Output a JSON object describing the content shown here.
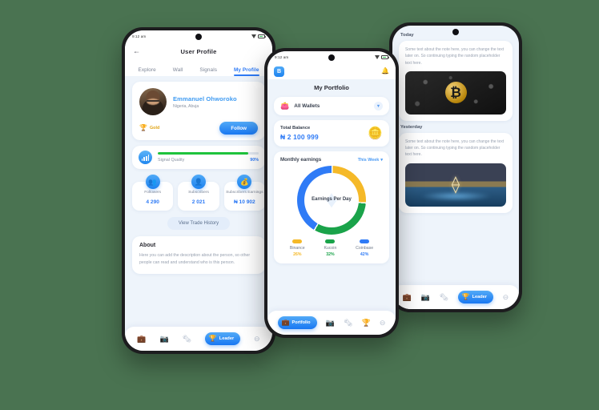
{
  "background_color": "#4a7351",
  "accent_color": "#2f7bf6",
  "phones": {
    "left": {
      "status_bar": {
        "time": "9:12 am",
        "wifi_icon": "wifi-icon",
        "battery_icon": "battery-icon"
      },
      "header": {
        "back_icon": "back-arrow-icon",
        "title": "User Profile"
      },
      "tabs": [
        {
          "label": "Explore",
          "active": false
        },
        {
          "label": "Wall",
          "active": false
        },
        {
          "label": "Signals",
          "active": false
        },
        {
          "label": "My Profile",
          "active": true
        }
      ],
      "profile": {
        "avatar": "user-avatar",
        "name": "Emmanuel Ohworoko",
        "location": "Nigeria, Abuja",
        "badge_icon": "trophy-icon",
        "badge_label": "Gold",
        "follow_label": "Follow"
      },
      "signal": {
        "icon": "signal-bars-icon",
        "label": "Signal Quality",
        "percent_label": "90%",
        "percent_value": 90,
        "bar_color": "#1ec33c"
      },
      "stats": [
        {
          "icon": "followers-icon",
          "glyph": "\u0001",
          "label": "Followers",
          "value": "4 290"
        },
        {
          "icon": "subscribers-icon",
          "glyph": "\u0001",
          "label": "Subscribers",
          "value": "2 021"
        },
        {
          "icon": "subscribers-earnings-icon",
          "glyph": "\u0001",
          "label": "Subscribers Earnings",
          "value": "₦ 10 902"
        }
      ],
      "history_button": "View Trade History",
      "about": {
        "title": "About",
        "text": "Here you can add the description about the person, so other people can read and understand who is this person."
      },
      "bottom_nav": {
        "items": [
          {
            "icon": "briefcase-icon",
            "glyph": "💼",
            "label": "",
            "active": false
          },
          {
            "icon": "wallet-icon",
            "glyph": "📷",
            "label": "",
            "active": false
          },
          {
            "icon": "news-icon",
            "glyph": "🗞",
            "label": "",
            "active": false
          },
          {
            "icon": "leader-trophy-icon",
            "glyph": "🏆",
            "label": "Leader",
            "active": true
          },
          {
            "icon": "more-icon",
            "glyph": "⊖",
            "label": "",
            "active": false
          }
        ]
      }
    },
    "middle": {
      "status_bar": {
        "time": "9:12 am",
        "wifi_icon": "wifi-icon",
        "battery_icon": "battery-icon"
      },
      "header": {
        "logo": "B",
        "logo_name": "app-logo",
        "bell_icon": "notification-bell-icon"
      },
      "title": "My Portfolio",
      "wallet_selector": {
        "icon": "wallet-icon",
        "label": "All Wallets",
        "chevron": "chevron-down-icon"
      },
      "balance": {
        "label": "Total Balance",
        "value": "₦ 2 100 999",
        "coins_icon": "coins-icon"
      },
      "earnings": {
        "title": "Monthly earnings",
        "filter_label": "This Week",
        "filter_chevron": "chevron-down-icon",
        "center_label": "Earnings Per Day"
      },
      "bottom_nav": {
        "items": [
          {
            "icon": "briefcase-icon",
            "glyph": "💼",
            "label": "Portfolio",
            "active": true
          },
          {
            "icon": "wallet-icon",
            "glyph": "📷",
            "label": "",
            "active": false
          },
          {
            "icon": "news-icon",
            "glyph": "🗞",
            "label": "",
            "active": false
          },
          {
            "icon": "leader-trophy-icon",
            "glyph": "🏆",
            "label": "",
            "active": false
          },
          {
            "icon": "more-icon",
            "glyph": "⊖",
            "label": "",
            "active": false
          }
        ]
      }
    },
    "right": {
      "notes": [
        {
          "day": "Today",
          "text": "Some text about the note here, you can change the text later on. So continuing typing the random placeholder text here.",
          "image": "bitcoin-coin-photo",
          "image_glyph": "₿"
        },
        {
          "day": "Yesterday",
          "text": "Some text about the note here, you can change the text later on. So continuing typing the random placeholder text here.",
          "image": "ethereum-sunset-photo",
          "image_glyph": "⟠"
        }
      ],
      "bottom_nav": {
        "items": [
          {
            "icon": "briefcase-icon",
            "glyph": "💼",
            "label": "",
            "active": false
          },
          {
            "icon": "wallet-icon",
            "glyph": "📷",
            "label": "",
            "active": false
          },
          {
            "icon": "news-icon",
            "glyph": "🗞",
            "label": "",
            "active": false
          },
          {
            "icon": "leader-trophy-icon",
            "glyph": "🏆",
            "label": "Leader",
            "active": true
          },
          {
            "icon": "more-icon",
            "glyph": "⊖",
            "label": "",
            "active": false
          }
        ]
      }
    }
  },
  "chart_data": {
    "type": "pie",
    "title": "Monthly earnings",
    "center_label": "Earnings Per Day",
    "categories": [
      "Binance",
      "Kucoin",
      "Coinbase"
    ],
    "values": [
      26,
      32,
      42
    ],
    "value_labels": [
      "26%",
      "32%",
      "42%"
    ],
    "colors": [
      "#f5b928",
      "#1aa34a",
      "#2f7bf6"
    ],
    "legend_position": "bottom",
    "donut": true,
    "start_angle": -90,
    "grid": false
  }
}
